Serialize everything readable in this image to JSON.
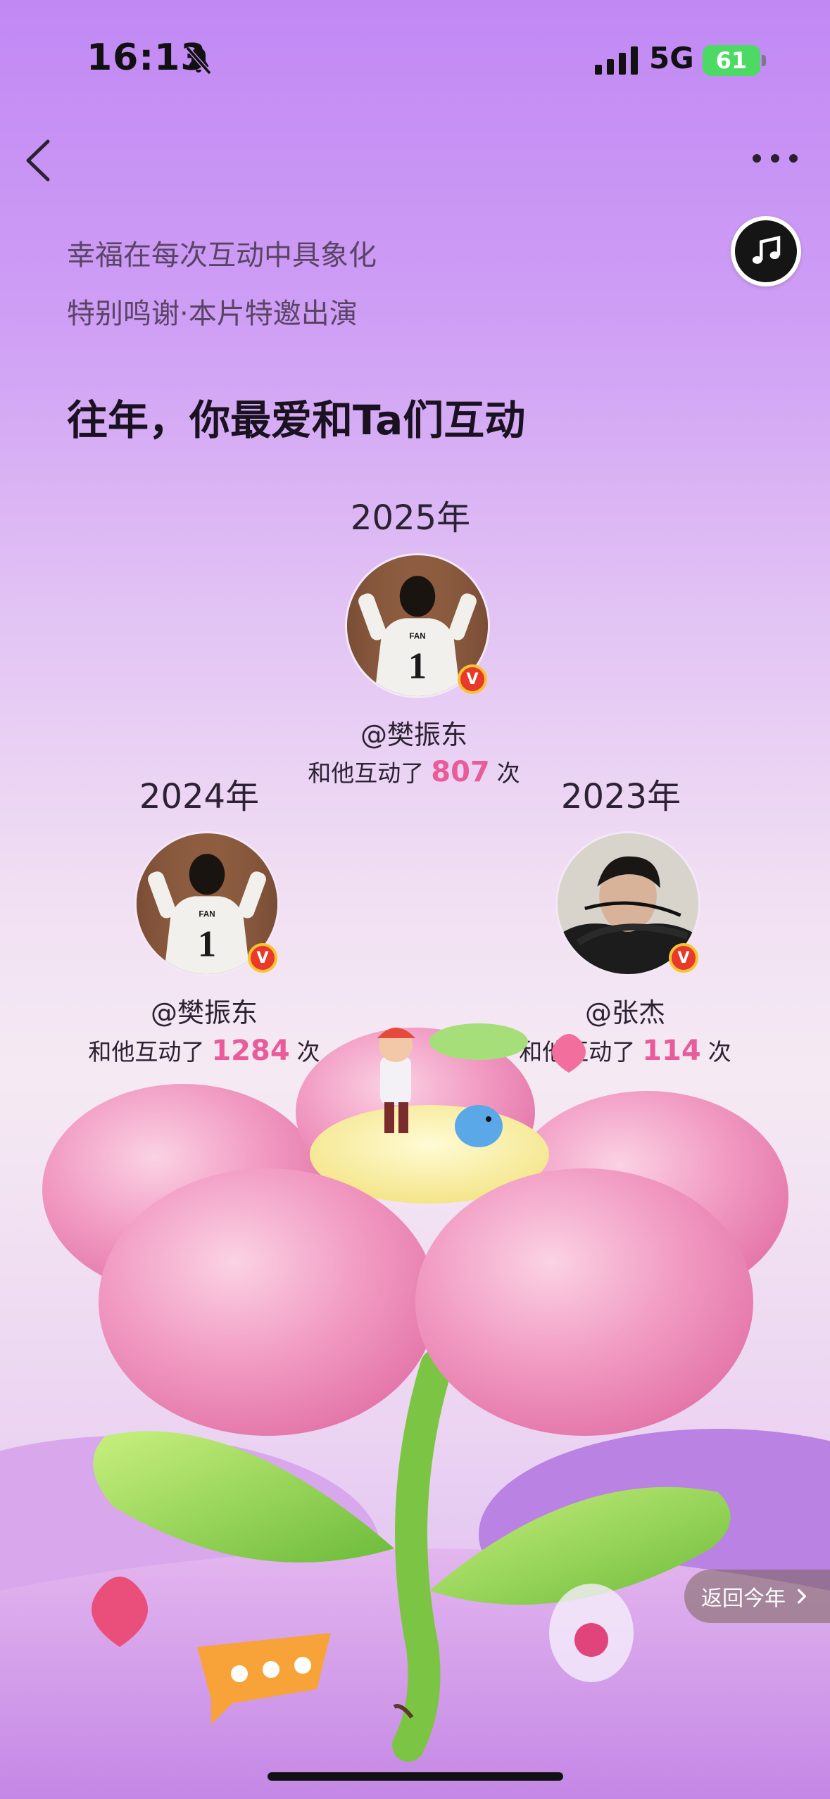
{
  "status_bar": {
    "time": "16:13",
    "network": "5G",
    "battery": "61"
  },
  "header": {
    "subtitle1": "幸福在每次互动中具象化",
    "subtitle2": "特别鸣谢·本片特邀出演",
    "title": "往年，你最爱和Ta们互动"
  },
  "years": [
    {
      "year": "2025年",
      "handle": "@樊振东",
      "prefix": "和他互动了",
      "count": "807",
      "suffix": "次"
    },
    {
      "year": "2024年",
      "handle": "@樊振东",
      "prefix": "和他互动了",
      "count": "1284",
      "suffix": "次"
    },
    {
      "year": "2023年",
      "handle": "@张杰",
      "prefix": "和他互动了",
      "count": "114",
      "suffix": "次"
    }
  ],
  "badge_letter": "V",
  "jersey": {
    "name": "FAN",
    "number": "1"
  },
  "return_label": "返回今年",
  "colors": {
    "accent": "#e85c9a",
    "verified": "#e8392a",
    "battery": "#4cd964"
  },
  "icons": [
    "bell-slash-icon",
    "signal-icon",
    "back-icon",
    "more-icon",
    "music-note-icon",
    "chevron-right-icon"
  ]
}
